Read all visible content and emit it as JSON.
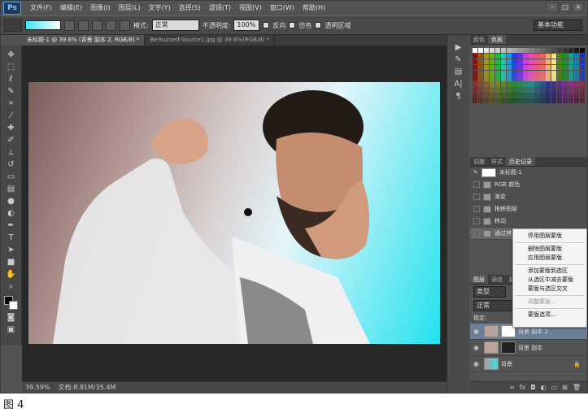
{
  "app": {
    "logo": "Ps",
    "workspace": "基本功能"
  },
  "menu": [
    "文件(F)",
    "编辑(E)",
    "图像(I)",
    "图层(L)",
    "文字(Y)",
    "选择(S)",
    "滤镜(T)",
    "视图(V)",
    "窗口(W)",
    "帮助(H)"
  ],
  "window_buttons": [
    "–",
    "□",
    "×"
  ],
  "options": {
    "mode_label": "模式:",
    "mode_value": "正常",
    "opacity_label": "不透明度:",
    "opacity_value": "100%",
    "reverse_label": "反向",
    "dither_label": "仿色",
    "transparency_label": "透明区域"
  },
  "tabs": [
    {
      "label": "未标题-1 @ 39.6% (背景 副本 2, RGB/8) *",
      "active": true
    },
    {
      "label": "BeYourself-Source1.jpg @ 39.6%(RGB/8) *",
      "active": false
    }
  ],
  "status": {
    "zoom": "39.59%",
    "doc": "文档:8.81M/35.4M"
  },
  "swatch_panel": {
    "tabs": [
      "颜色",
      "色板"
    ]
  },
  "history": {
    "tabs": [
      "调整",
      "样式",
      "历史记录"
    ],
    "snapshot": "未标题-1",
    "items": [
      "RGB 颜色",
      "渐变",
      "拖移图层",
      "移动",
      "通过拷贝的图层"
    ]
  },
  "layers": {
    "tabs": [
      "图层",
      "通道",
      "路径"
    ],
    "filter": "类型",
    "blend": "正常",
    "lock_label": "锁定:",
    "items": [
      {
        "name": "背景 副本 2",
        "selected": true
      },
      {
        "name": "背景 副本",
        "selected": false
      },
      {
        "name": "背景",
        "selected": false,
        "locked": true
      }
    ]
  },
  "context_menu": {
    "groups": [
      [
        "停用图层蒙版"
      ],
      [
        "删除图层蒙版",
        "应用图层蒙版"
      ],
      [
        "添加蒙版到选区",
        "从选区中减去蒙版",
        "蒙版与选区交叉"
      ],
      [
        "调整蒙版..."
      ],
      [
        "蒙版选项..."
      ]
    ],
    "disabled": [
      "调整蒙版..."
    ]
  },
  "caption": "图 4",
  "colors": {
    "accent": "#2fe0ec",
    "panel_bg": "#535353",
    "canvas_bg": "#282828"
  }
}
